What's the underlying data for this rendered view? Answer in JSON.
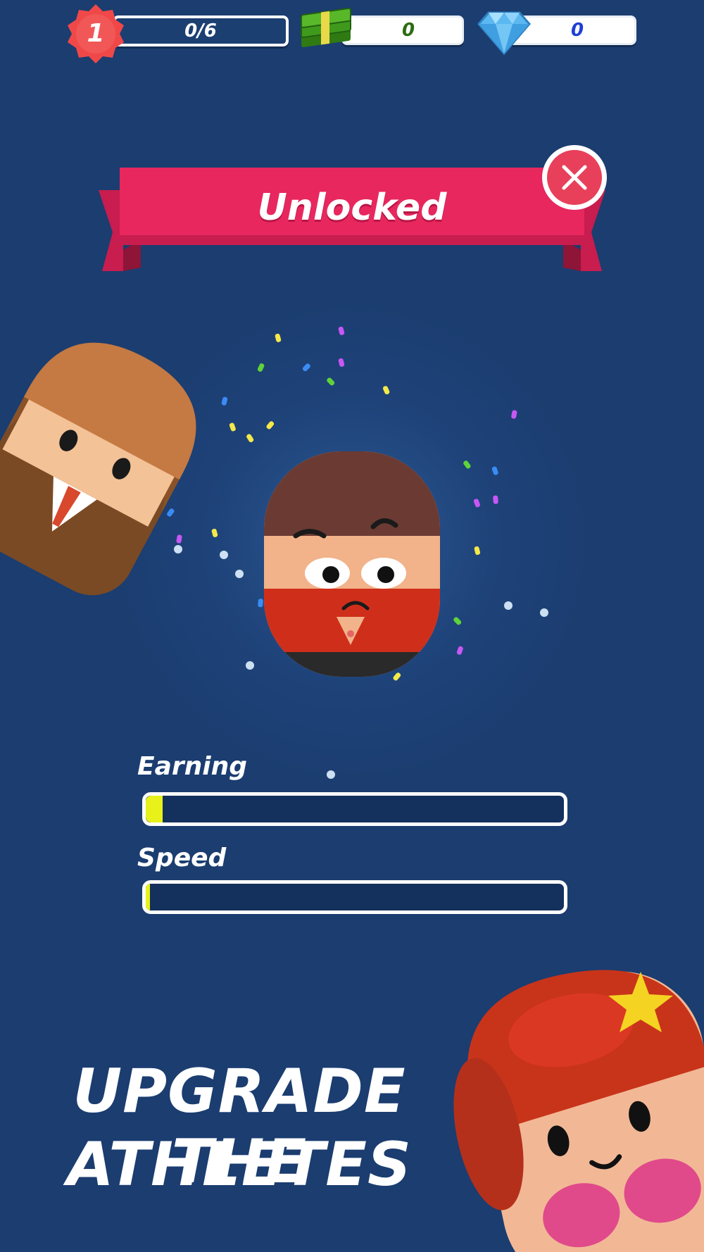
{
  "hud": {
    "level": {
      "number": "1",
      "progress_text": "0/6",
      "icon": "level-badge-icon"
    },
    "cash": {
      "value": "0",
      "icon": "cash-stack-icon"
    },
    "gems": {
      "value": "0",
      "icon": "diamond-icon"
    }
  },
  "banner": {
    "title": "Unlocked",
    "close_icon": "close-icon"
  },
  "character": {
    "name_hidden": true
  },
  "stats": [
    {
      "label": "Earning",
      "level": 0.04
    },
    {
      "label": "Speed",
      "level": 0.01
    }
  ],
  "caption": {
    "line1": "UPGRADE THE",
    "line2": "ATHLETES"
  },
  "colors": {
    "background": "#1b3d70",
    "banner": "#e8275f",
    "close_button": "#e8405a",
    "bar_fill": "#e8f21a",
    "level_badge": "#f04848"
  }
}
